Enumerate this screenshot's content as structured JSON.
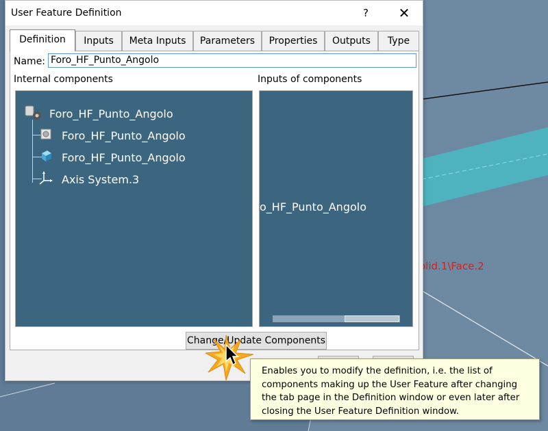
{
  "dialog": {
    "title": "User Feature Definition",
    "help_label": "?",
    "close_label": "✕"
  },
  "tabs": [
    {
      "label": "Definition",
      "active": true
    },
    {
      "label": "Inputs"
    },
    {
      "label": "Meta Inputs"
    },
    {
      "label": "Parameters"
    },
    {
      "label": "Properties"
    },
    {
      "label": "Outputs"
    },
    {
      "label": "Type"
    }
  ],
  "name_field": {
    "label": "Name:",
    "value": "Foro_HF_Punto_Angolo"
  },
  "internal_components": {
    "label": "Internal components",
    "tree": [
      {
        "label": "Foro_HF_Punto_Angolo",
        "icon": "user-feature-icon"
      },
      {
        "label": "Foro_HF_Punto_Angolo",
        "icon": "hole-feature-icon"
      },
      {
        "label": "Foro_HF_Punto_Angolo",
        "icon": "solid-body-icon"
      },
      {
        "label": "Axis System.3",
        "icon": "axis-system-icon"
      }
    ]
  },
  "inputs_of_components": {
    "label": "Inputs of components",
    "item": "o_HF_Punto_Angolo"
  },
  "change_button": {
    "label": "Change/Update Components"
  },
  "viewport": {
    "annotation": "olid.1\\Face.2"
  },
  "tooltip": {
    "text": "Enables you to modify the definition, i.e. the list of components making up the User Feature after changing the tab page in the Definition window or even later after closing the User Feature Definition window."
  },
  "colors": {
    "panel_bg": "#3c6580",
    "viewport_bg": "#5f7b95",
    "beam": "#4fb3bf",
    "annotation": "#d8211e",
    "tooltip_bg": "#ffffe1"
  }
}
